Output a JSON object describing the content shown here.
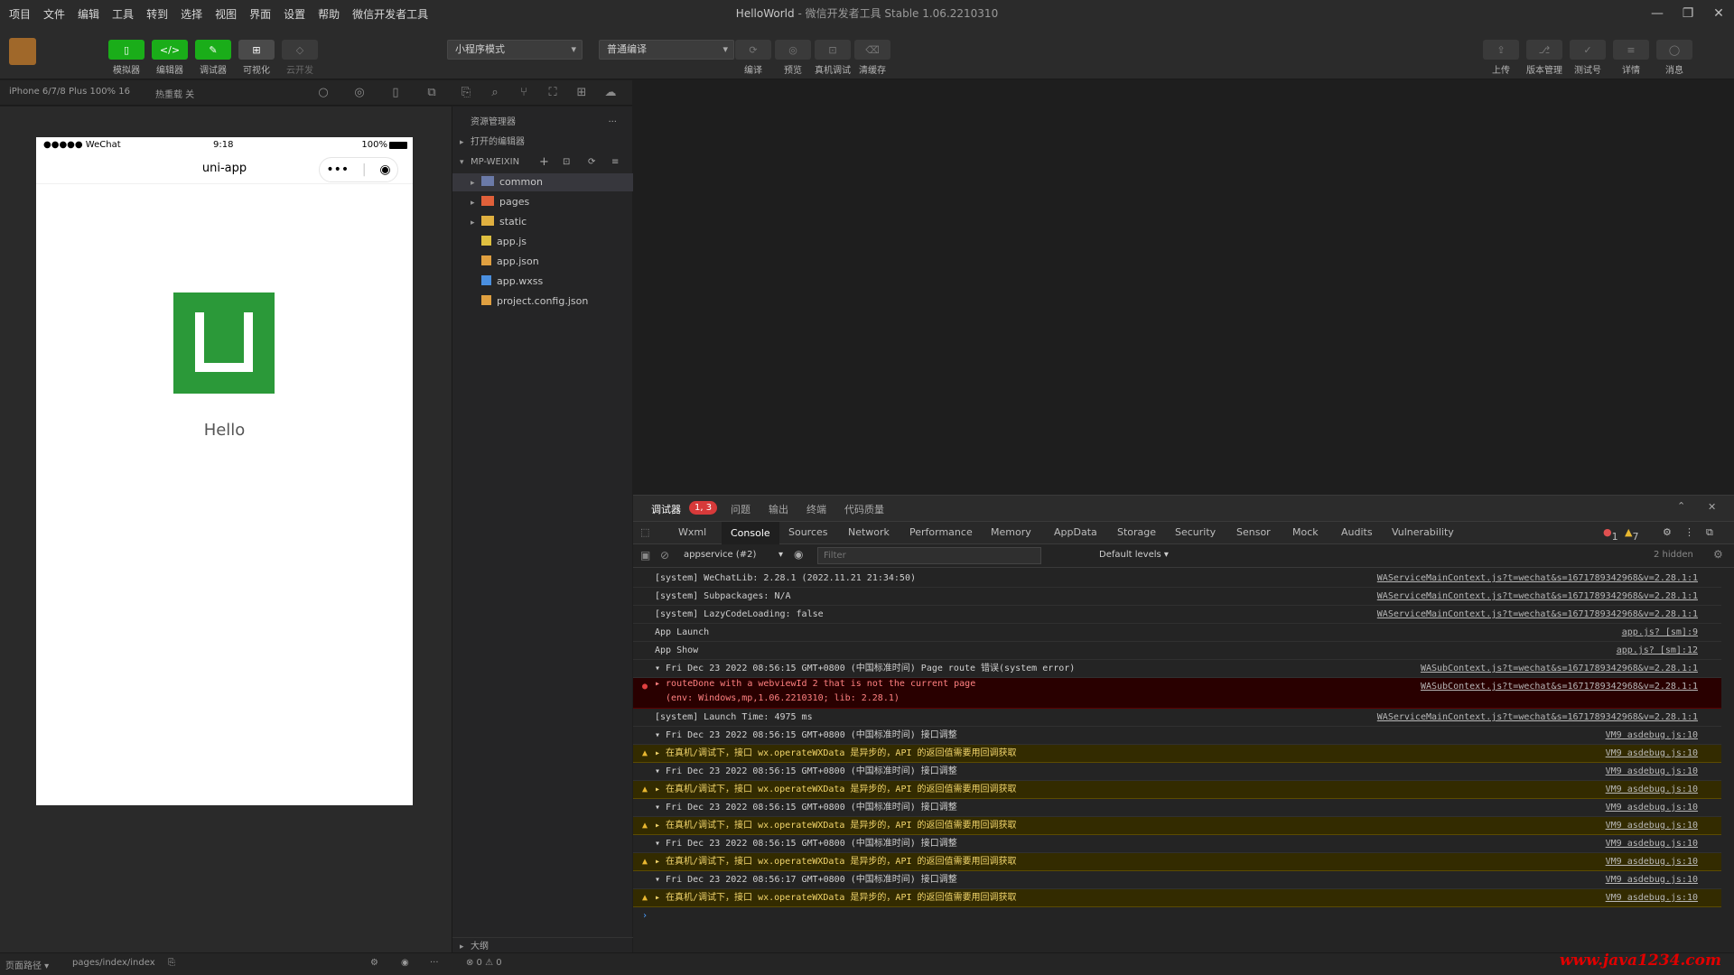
{
  "menu": [
    "项目",
    "文件",
    "编辑",
    "工具",
    "转到",
    "选择",
    "视图",
    "界面",
    "设置",
    "帮助",
    "微信开发者工具"
  ],
  "window": {
    "title": "HelloWorld",
    "subtitle": "- 微信开发者工具 Stable 1.06.2210310"
  },
  "toolbar": {
    "left_buttons": [
      {
        "label": "模拟器",
        "glyph": "▯",
        "style": "green"
      },
      {
        "label": "编辑器",
        "glyph": "</>",
        "style": "green"
      },
      {
        "label": "调试器",
        "glyph": "✎",
        "style": "green"
      },
      {
        "label": "可视化",
        "glyph": "⊞",
        "style": "grey"
      },
      {
        "label": "云开发",
        "glyph": "◇",
        "style": "dark"
      }
    ],
    "mode_select": "小程序模式",
    "compile_select": "普通编译",
    "center_buttons": [
      {
        "label": "编译",
        "glyph": "⟳"
      },
      {
        "label": "预览",
        "glyph": "◎"
      },
      {
        "label": "真机调试",
        "glyph": "⊡"
      },
      {
        "label": "清缓存",
        "glyph": "⌫"
      }
    ],
    "right_buttons": [
      {
        "label": "上传",
        "glyph": "⇪"
      },
      {
        "label": "版本管理",
        "glyph": "⎇"
      },
      {
        "label": "测试号",
        "glyph": "✓"
      },
      {
        "label": "详情",
        "glyph": "≡"
      },
      {
        "label": "消息",
        "glyph": "◯"
      }
    ]
  },
  "subbar": {
    "device": "iPhone 6/7/8 Plus 100% 16",
    "hotreload": "热重载 关"
  },
  "phone": {
    "carrier": "●●●●● WeChat",
    "time": "9:18",
    "battery": "100%",
    "nav_title": "uni-app",
    "capsule_more": "•••",
    "capsule_close": "◉",
    "hello": "Hello"
  },
  "explorer": {
    "title": "资源管理器",
    "open_editors": "打开的编辑器",
    "project": "MP-WEIXIN",
    "items": [
      {
        "name": "common",
        "type": "folder",
        "expand": true,
        "color": "#6b7aa8"
      },
      {
        "name": "pages",
        "type": "folder",
        "expand": true,
        "color": "#e0603a"
      },
      {
        "name": "static",
        "type": "folder",
        "expand": true,
        "color": "#e0b040"
      },
      {
        "name": "app.js",
        "type": "file",
        "expand": false,
        "color": "#e0c040"
      },
      {
        "name": "app.json",
        "type": "file",
        "expand": false,
        "color": "#e0a040"
      },
      {
        "name": "app.wxss",
        "type": "file",
        "expand": false,
        "color": "#4a8fe0"
      },
      {
        "name": "project.config.json",
        "type": "file",
        "expand": false,
        "color": "#e0a040"
      }
    ],
    "outline": "大纲"
  },
  "debugger": {
    "tabs": [
      "调试器",
      "问题",
      "输出",
      "终端",
      "代码质量"
    ],
    "badge": "1, 3",
    "devtools_tabs": [
      "Wxml",
      "Console",
      "Sources",
      "Network",
      "Performance",
      "Memory",
      "AppData",
      "Storage",
      "Security",
      "Sensor",
      "Mock",
      "Audits",
      "Vulnerability"
    ],
    "active_tab": "Console",
    "err_count": "1",
    "warn_count": "7",
    "context": "appservice (#2)",
    "filter_placeholder": "Filter",
    "levels": "Default levels ▾",
    "hidden": "2 hidden",
    "lines": [
      {
        "kind": "info",
        "msg": "[system] WeChatLib: 2.28.1 (2022.11.21 21:34:50)",
        "src": "WAServiceMainContext.js?t=wechat&s=1671789342968&v=2.28.1:1"
      },
      {
        "kind": "info",
        "msg": "[system] Subpackages: N/A",
        "src": "WAServiceMainContext.js?t=wechat&s=1671789342968&v=2.28.1:1"
      },
      {
        "kind": "info",
        "msg": "[system] LazyCodeLoading: false",
        "src": "WAServiceMainContext.js?t=wechat&s=1671789342968&v=2.28.1:1"
      },
      {
        "kind": "info",
        "msg": "App Launch",
        "src": "app.js? [sm]:9"
      },
      {
        "kind": "info",
        "msg": "App Show",
        "src": "app.js? [sm]:12"
      },
      {
        "kind": "group",
        "msg": "▾ Fri Dec 23 2022 08:56:15 GMT+0800 (中国标准时间) Page route 错误(system error)",
        "src": "WASubContext.js?t=wechat&s=1671789342968&v=2.28.1:1"
      },
      {
        "kind": "err",
        "msg": "▸ routeDone with a webviewId 2 that is not the current page",
        "msg2": "(env: Windows,mp,1.06.2210310; lib: 2.28.1)",
        "src": "WASubContext.js?t=wechat&s=1671789342968&v=2.28.1:1"
      },
      {
        "kind": "info",
        "msg": "[system] Launch Time: 4975 ms",
        "src": "WAServiceMainContext.js?t=wechat&s=1671789342968&v=2.28.1:1"
      },
      {
        "kind": "group",
        "msg": "▾ Fri Dec 23 2022 08:56:15 GMT+0800 (中国标准时间) 接口调整",
        "src": "VM9 asdebug.js:10"
      },
      {
        "kind": "warn",
        "msg": "▸ 在真机/调试下，接口 wx.operateWXData 是异步的，API 的返回值需要用回调获取",
        "src": "VM9 asdebug.js:10"
      },
      {
        "kind": "group",
        "msg": "▾ Fri Dec 23 2022 08:56:15 GMT+0800 (中国标准时间) 接口调整",
        "src": "VM9 asdebug.js:10"
      },
      {
        "kind": "warn",
        "msg": "▸ 在真机/调试下，接口 wx.operateWXData 是异步的，API 的返回值需要用回调获取",
        "src": "VM9 asdebug.js:10"
      },
      {
        "kind": "group",
        "msg": "▾ Fri Dec 23 2022 08:56:15 GMT+0800 (中国标准时间) 接口调整",
        "src": "VM9 asdebug.js:10"
      },
      {
        "kind": "warn",
        "msg": "▸ 在真机/调试下，接口 wx.operateWXData 是异步的，API 的返回值需要用回调获取",
        "src": "VM9 asdebug.js:10"
      },
      {
        "kind": "group",
        "msg": "▾ Fri Dec 23 2022 08:56:15 GMT+0800 (中国标准时间) 接口调整",
        "src": "VM9 asdebug.js:10"
      },
      {
        "kind": "warn",
        "msg": "▸ 在真机/调试下，接口 wx.operateWXData 是异步的，API 的返回值需要用回调获取",
        "src": "VM9 asdebug.js:10"
      },
      {
        "kind": "group",
        "msg": "▾ Fri Dec 23 2022 08:56:17 GMT+0800 (中国标准时间) 接口调整",
        "src": "VM9 asdebug.js:10"
      },
      {
        "kind": "warn",
        "msg": "▸ 在真机/调试下，接口 wx.operateWXData 是异步的，API 的返回值需要用回调获取",
        "src": "VM9 asdebug.js:10"
      }
    ],
    "prompt": "›"
  },
  "status": {
    "path_label": "页面路径 ▾",
    "path": "pages/index/index",
    "counts": "⊗ 0 ⚠ 0"
  },
  "watermark": "www.java1234.com"
}
